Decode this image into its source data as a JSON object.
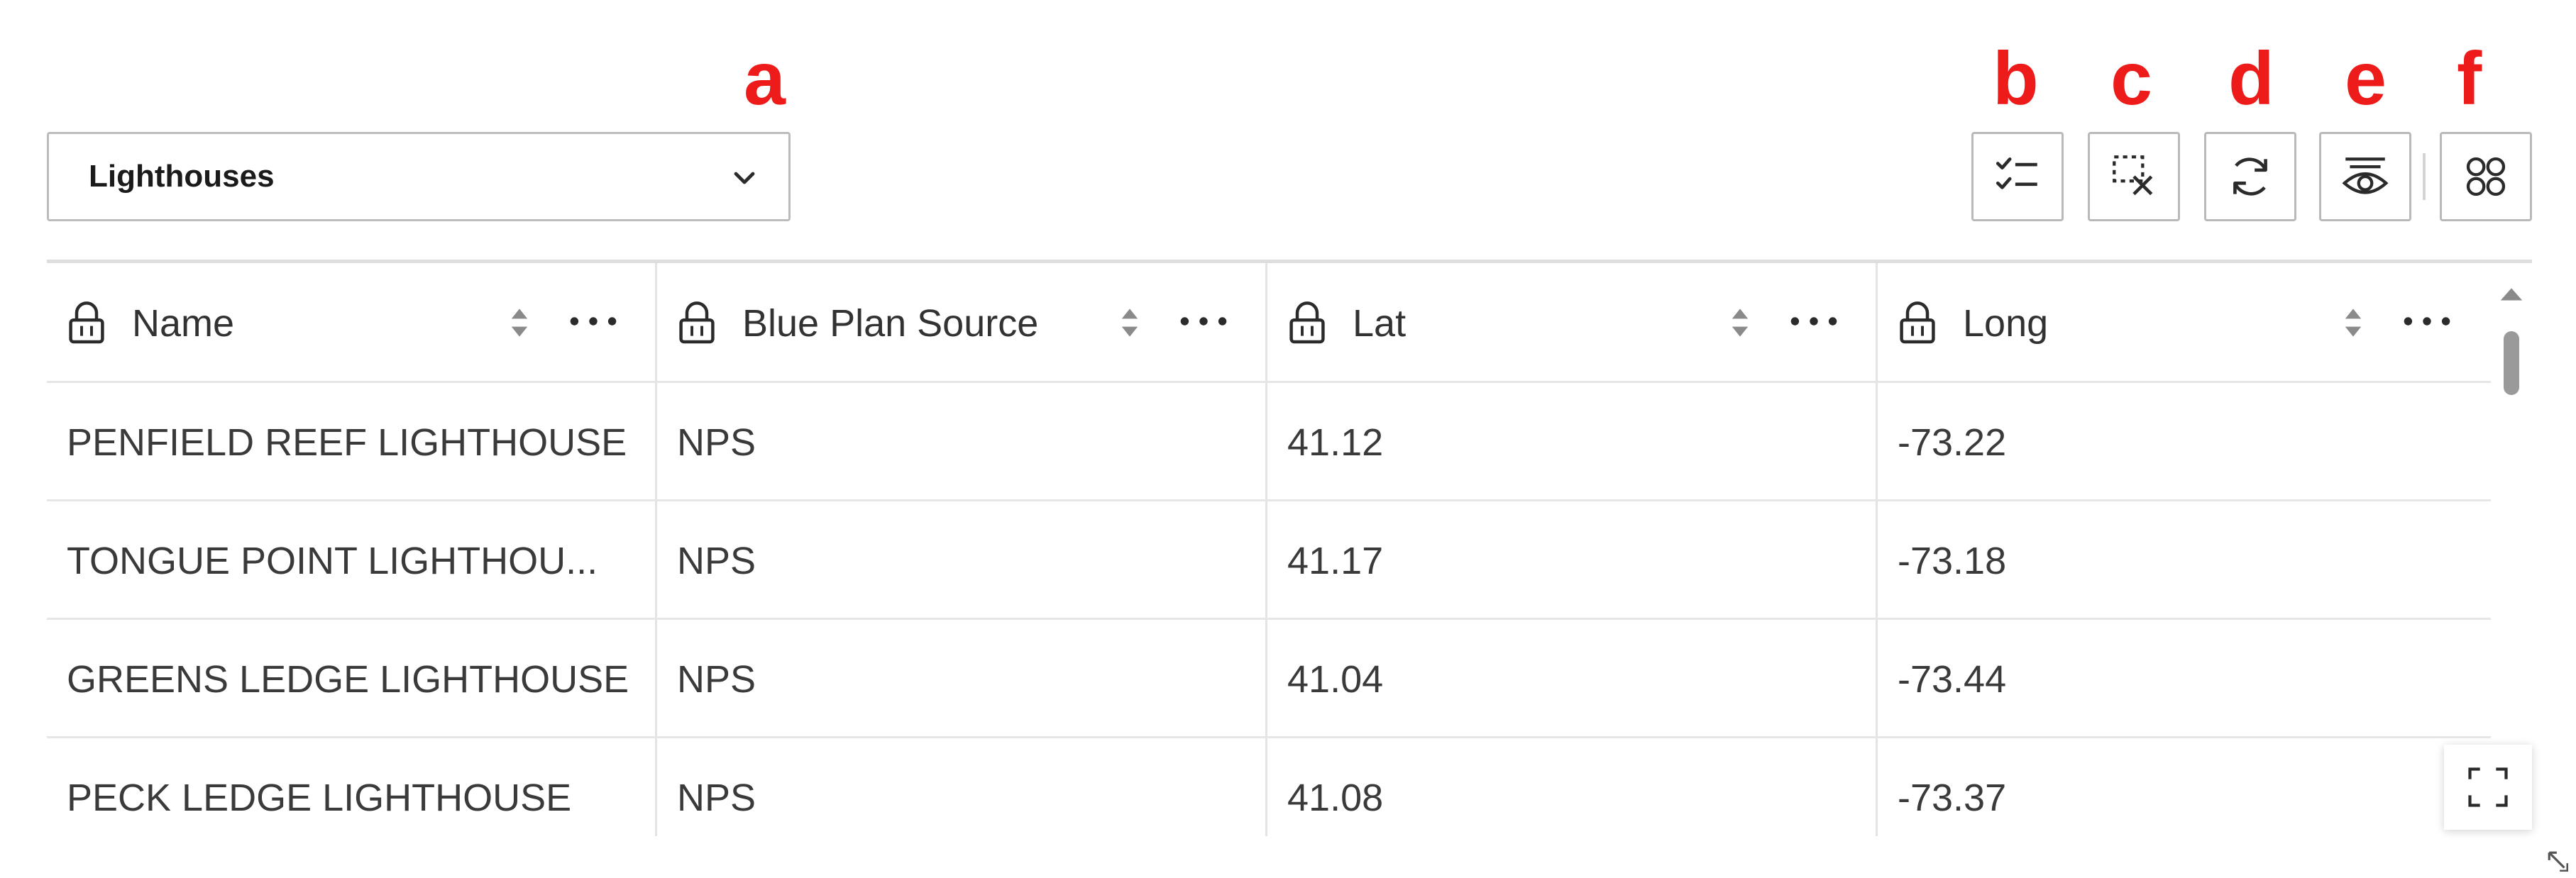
{
  "annotations": [
    "a",
    "b",
    "c",
    "d",
    "e",
    "f"
  ],
  "layer_selector": {
    "selected": "Lighthouses"
  },
  "toolbar": {
    "buttons": [
      {
        "id": "b",
        "icon": "select-all-icon"
      },
      {
        "id": "c",
        "icon": "clear-selection-icon"
      },
      {
        "id": "d",
        "icon": "refresh-icon"
      },
      {
        "id": "e",
        "icon": "show-selection-icon"
      },
      {
        "id": "f",
        "icon": "column-toggle-icon"
      }
    ]
  },
  "table": {
    "columns": [
      "Name",
      "Blue Plan Source",
      "Lat",
      "Long"
    ],
    "rows": [
      [
        "PENFIELD REEF LIGHTHOUSE",
        "NPS",
        "41.12",
        "-73.22"
      ],
      [
        "TONGUE POINT LIGHTHOU...",
        "NPS",
        "41.17",
        "-73.18"
      ],
      [
        "GREENS LEDGE LIGHTHOUSE",
        "NPS",
        "41.04",
        "-73.44"
      ],
      [
        "PECK LEDGE LIGHTHOUSE",
        "NPS",
        "41.08",
        "-73.37"
      ]
    ]
  },
  "colors": {
    "annotation": "#ee1b1b",
    "icon": "#2b2b2b",
    "border": "#bcbcbc"
  }
}
